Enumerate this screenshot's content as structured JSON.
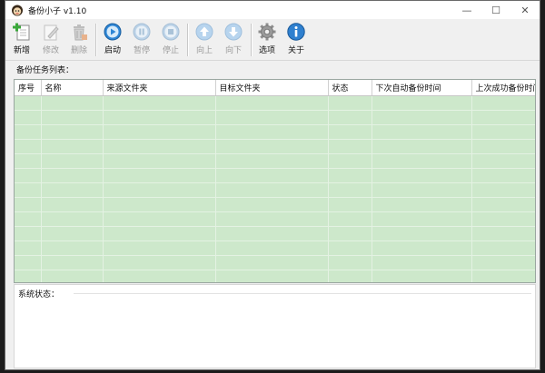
{
  "window": {
    "title": "备份小子 v1.10",
    "controls": {
      "minimize": "—",
      "maximize": "☐",
      "close": "✕"
    }
  },
  "toolbar": {
    "buttons": [
      {
        "label": "新增",
        "icon": "add-document-icon",
        "enabled": true
      },
      {
        "label": "修改",
        "icon": "edit-icon",
        "enabled": false
      },
      {
        "label": "删除",
        "icon": "trash-icon",
        "enabled": false
      },
      {
        "label": "启动",
        "icon": "play-icon",
        "enabled": true
      },
      {
        "label": "暂停",
        "icon": "pause-icon",
        "enabled": false
      },
      {
        "label": "停止",
        "icon": "stop-icon",
        "enabled": false
      },
      {
        "label": "向上",
        "icon": "arrow-up-icon",
        "enabled": false
      },
      {
        "label": "向下",
        "icon": "arrow-down-icon",
        "enabled": false
      },
      {
        "label": "选项",
        "icon": "gear-icon",
        "enabled": true
      },
      {
        "label": "关于",
        "icon": "info-icon",
        "enabled": true
      }
    ]
  },
  "task_list": {
    "label": "备份任务列表：",
    "columns": [
      "序号",
      "名称",
      "来源文件夹",
      "目标文件夹",
      "状态",
      "下次自动备份时间",
      "上次成功备份时间"
    ],
    "rows": []
  },
  "system_status": {
    "label": "系统状态："
  },
  "colors": {
    "grid_background": "#cde8cb",
    "accent_blue": "#2e86d6",
    "add_green": "#3aa83a"
  }
}
